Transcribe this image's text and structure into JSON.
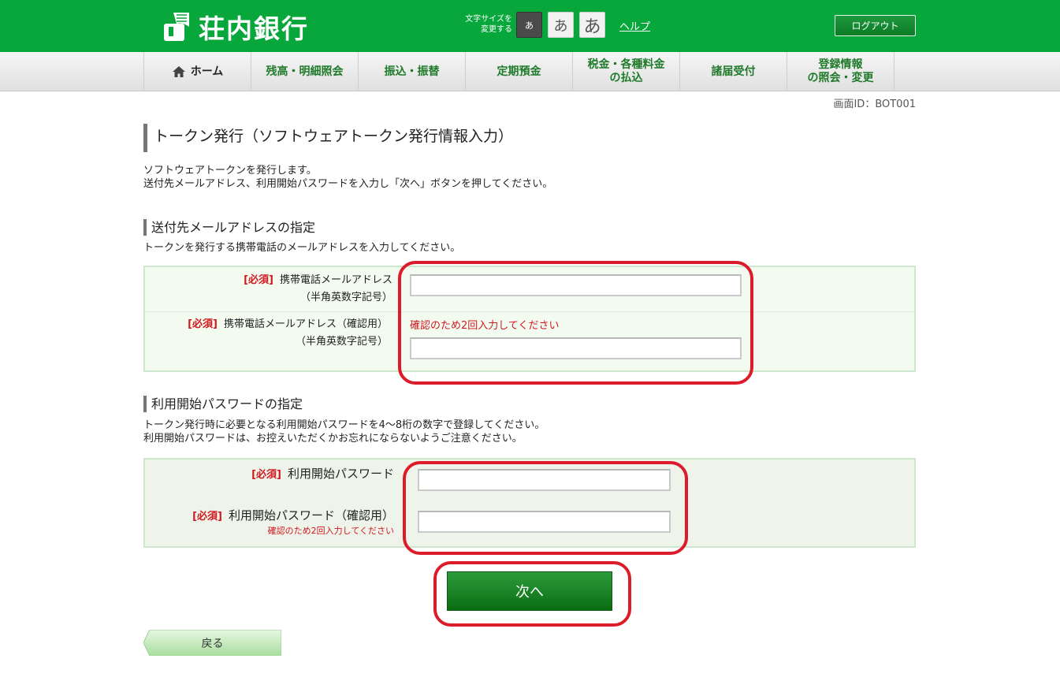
{
  "header": {
    "bank_name": "荘内銀行",
    "font_size_label_line1": "文字サイズを",
    "font_size_label_line2": "変更する",
    "font_small": "あ",
    "font_medium": "あ",
    "font_large": "あ",
    "help": "ヘルプ",
    "logout": "ログアウト"
  },
  "nav": {
    "items": [
      {
        "label": "ホーム",
        "icon": "home-icon"
      },
      {
        "label": "残高・明細照会"
      },
      {
        "label": "振込・振替"
      },
      {
        "label": "定期預金"
      },
      {
        "label": "税金・各種料金\nの払込"
      },
      {
        "label": "諸届受付"
      },
      {
        "label": "登録情報\nの照会・変更"
      }
    ]
  },
  "screen_id": "画面ID：BOT001",
  "page": {
    "title": "トークン発行（ソフトウェアトークン発行情報入力）",
    "intro_line1": "ソフトウェアトークンを発行します。",
    "intro_line2": "送付先メールアドレス、利用開始パスワードを入力し「次へ」ボタンを押してください。"
  },
  "email_section": {
    "title": "送付先メールアドレスの指定",
    "desc": "トークンを発行する携帯電話のメールアドレスを入力してください。",
    "required": "[必須]",
    "field1_label": "携帯電話メールアドレス",
    "field1_sub": "（半角英数字記号）",
    "field1_value": "",
    "field2_label": "携帯電話メールアドレス（確認用）",
    "field2_sub": "（半角英数字記号）",
    "field2_hint": "確認のため2回入力してください",
    "field2_value": ""
  },
  "password_section": {
    "title": "利用開始パスワードの指定",
    "desc_line1": "トークン発行時に必要となる利用開始パスワードを4～8桁の数字で登録してください。",
    "desc_line2": "利用開始パスワードは、お控えいただくかお忘れにならないようご注意ください。",
    "required": "[必須]",
    "field1_label": "利用開始パスワード",
    "field1_value": "",
    "field2_label": "利用開始パスワード（確認用）",
    "field2_hint": "確認のため2回入力してください",
    "field2_value": ""
  },
  "actions": {
    "next": "次へ",
    "back": "戻る"
  },
  "colors": {
    "brand_green": "#08a73c",
    "required_red": "#d0181f",
    "highlight_red": "#dc1c2a"
  }
}
